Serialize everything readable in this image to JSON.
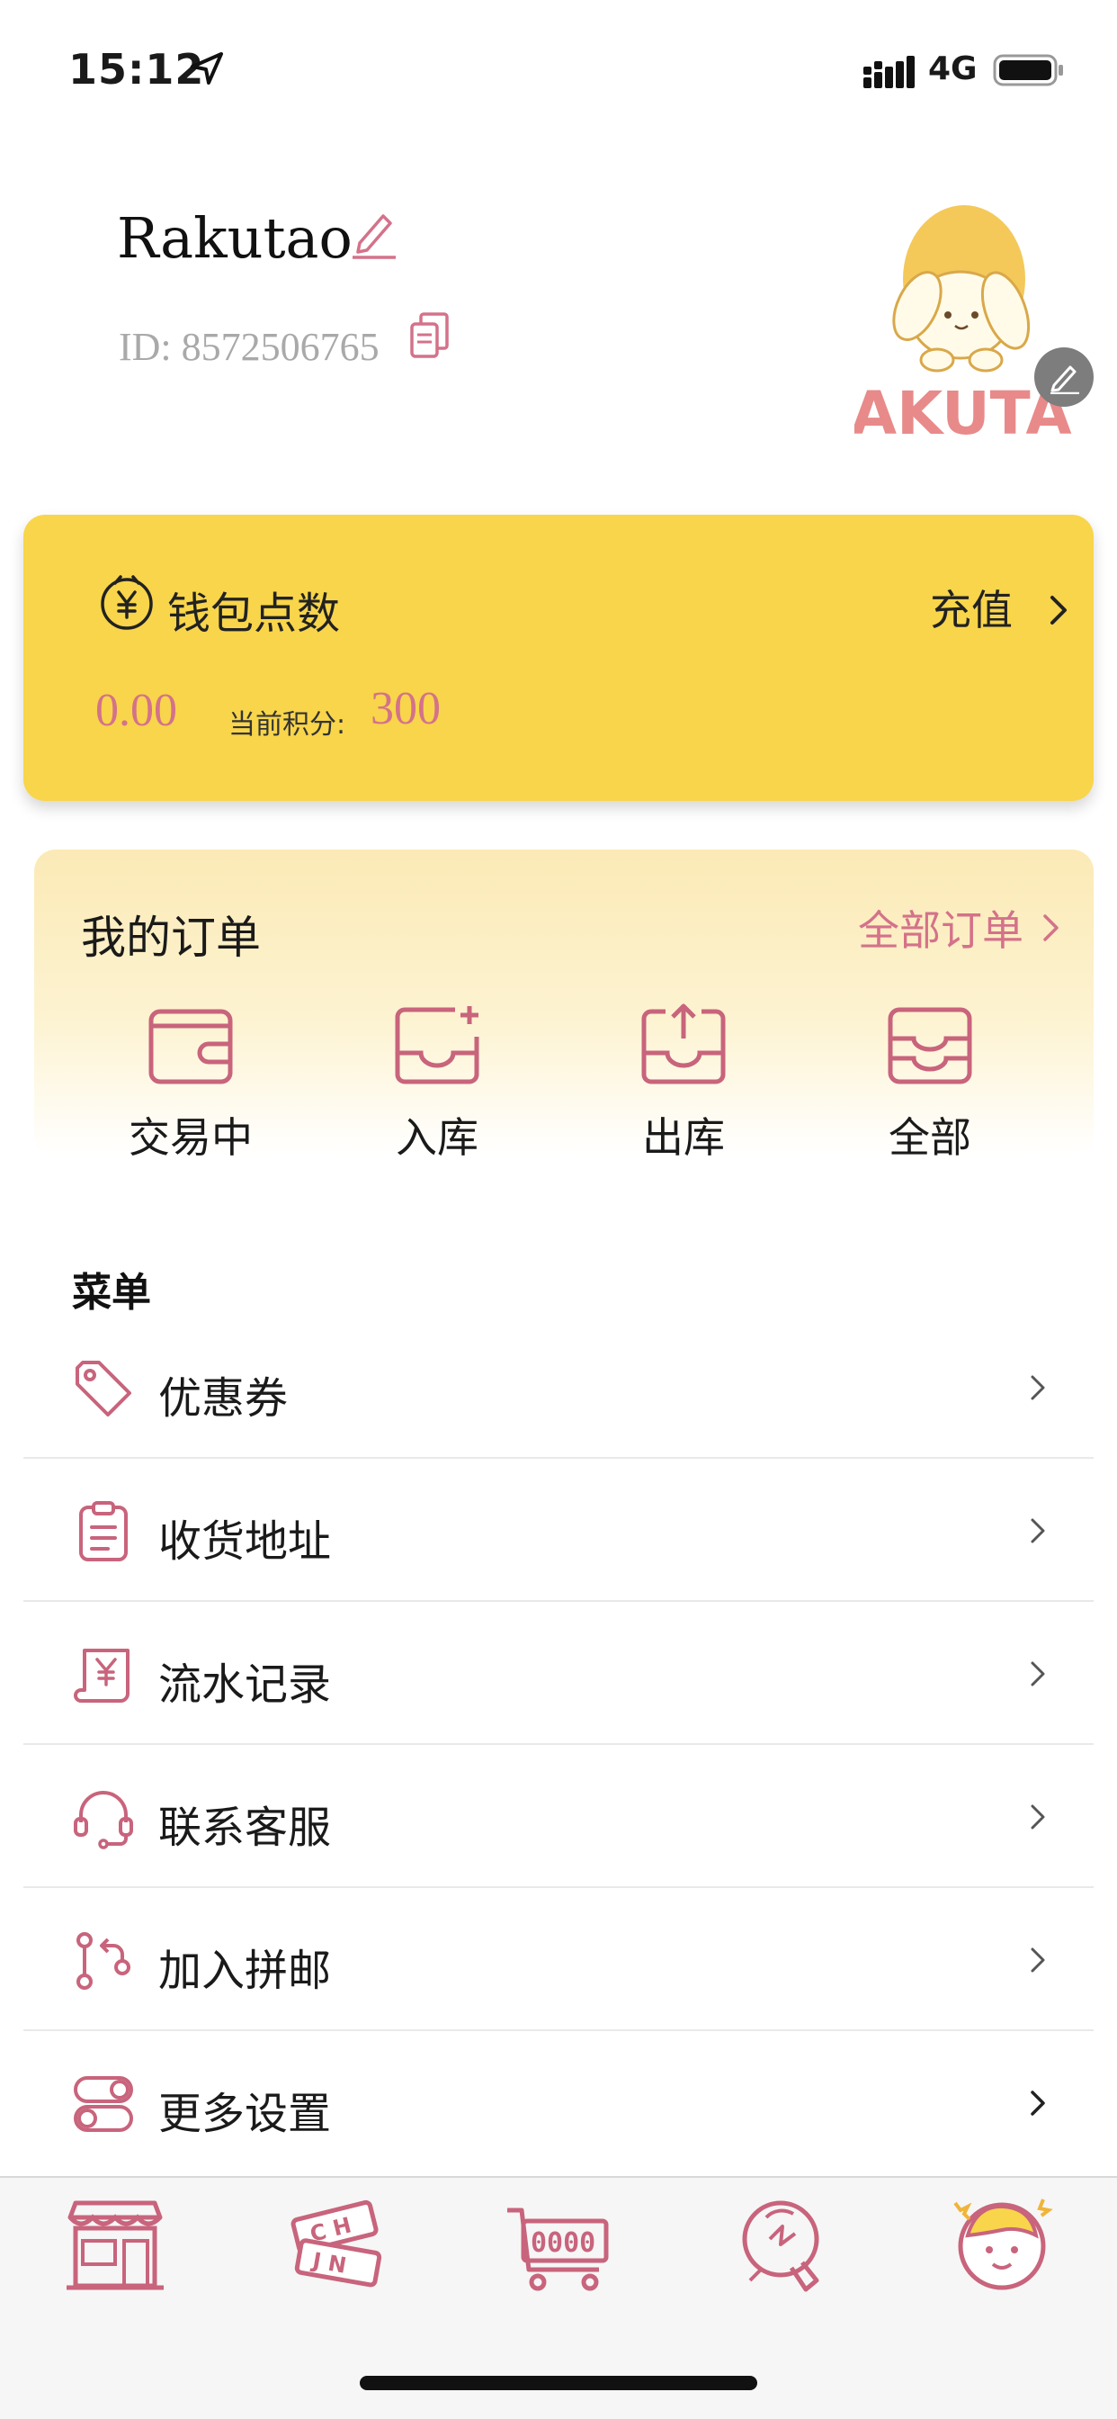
{
  "status_bar": {
    "time": "15:12",
    "network": "4G"
  },
  "profile": {
    "username": "Rakutao",
    "id_text": "ID: 8572506765",
    "avatar_logo_text": "AKUTA"
  },
  "wallet": {
    "title": "钱包点数",
    "recharge_label": "充值",
    "balance": "0.00",
    "points_label": "当前积分:",
    "points_value": "300"
  },
  "orders": {
    "title": "我的订单",
    "all_orders_label": "全部订单",
    "items": [
      {
        "label": "交易中",
        "icon": "wallet-icon"
      },
      {
        "label": "入库",
        "icon": "inbox-plus-icon"
      },
      {
        "label": "出库",
        "icon": "outbox-upload-icon"
      },
      {
        "label": "全部",
        "icon": "archive-icon"
      }
    ]
  },
  "menu": {
    "heading": "菜单",
    "items": [
      {
        "label": "优惠券",
        "icon": "tag-icon"
      },
      {
        "label": "收货地址",
        "icon": "clipboard-icon"
      },
      {
        "label": "流水记录",
        "icon": "receipt-scroll-icon"
      },
      {
        "label": "联系客服",
        "icon": "headset-icon"
      },
      {
        "label": "加入拼邮",
        "icon": "merge-branch-icon"
      },
      {
        "label": "更多设置",
        "icon": "toggle-settings-icon"
      }
    ]
  },
  "tab_bar": {
    "items": [
      {
        "icon": "shop-icon"
      },
      {
        "icon": "tickets-icon"
      },
      {
        "icon": "cart-icon"
      },
      {
        "icon": "idea-bulb-icon"
      },
      {
        "icon": "profile-character-icon"
      }
    ]
  },
  "colors": {
    "accent": "#d4728a",
    "wallet_yellow": "#f8d54a",
    "orders_gradient_top": "#fbeab6"
  }
}
